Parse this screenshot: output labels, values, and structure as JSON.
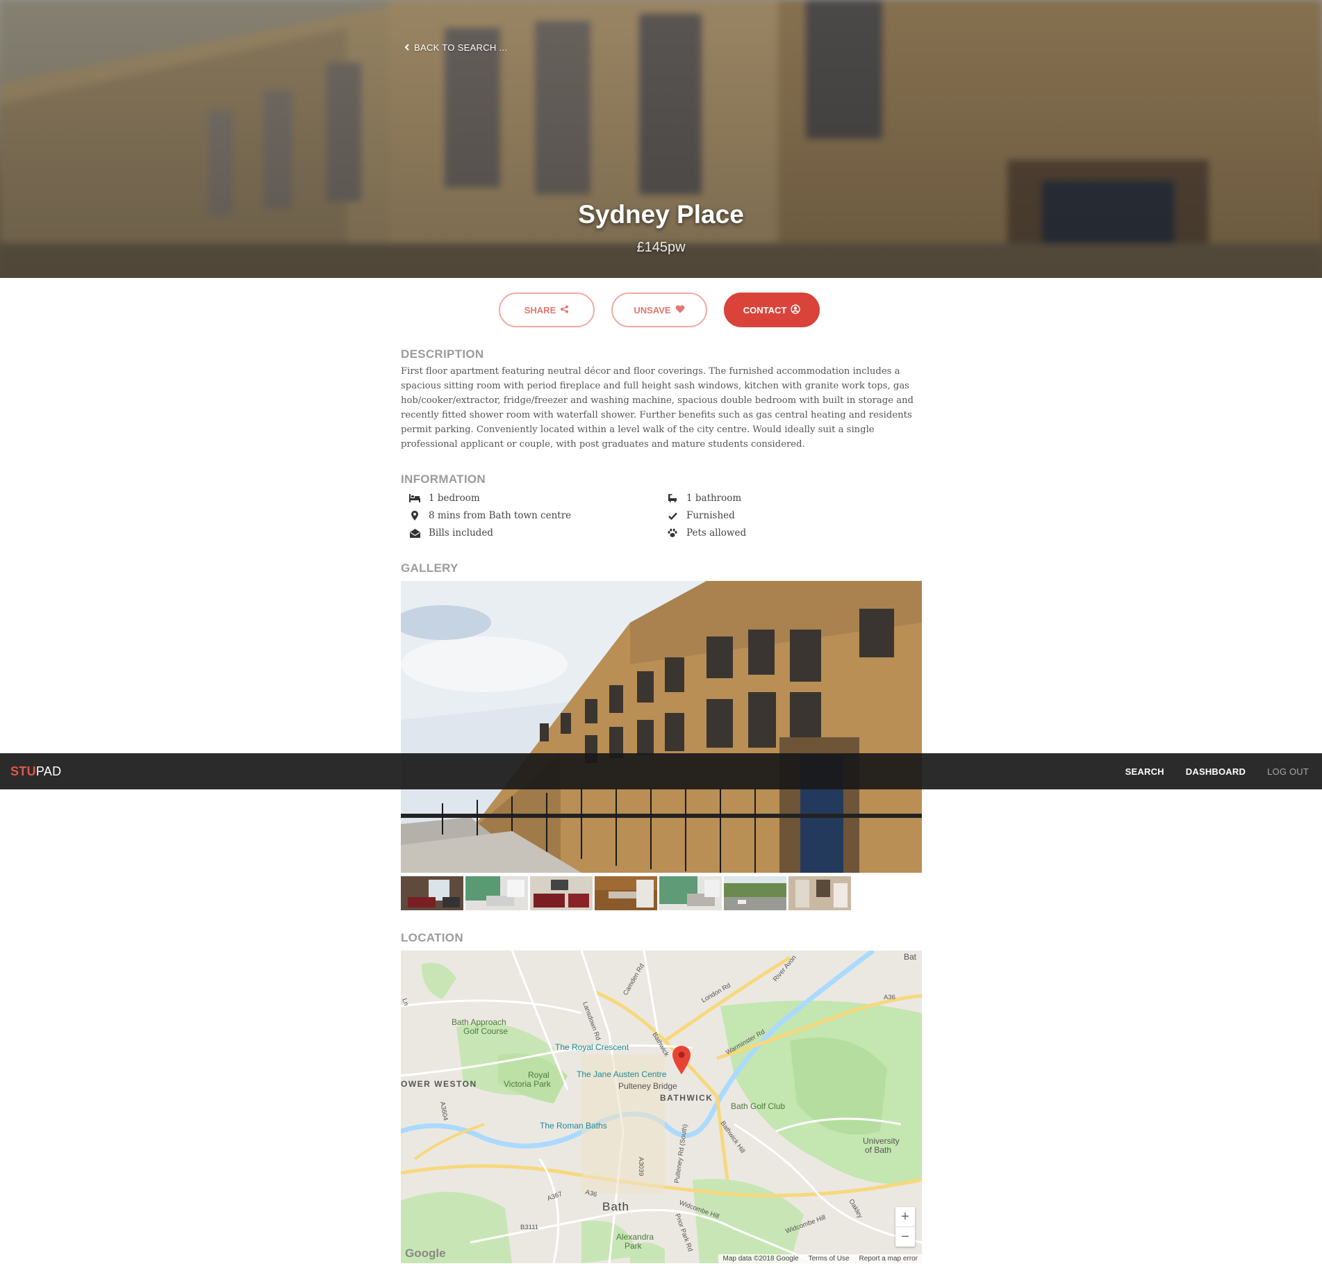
{
  "hero": {
    "back_label": "BACK TO SEARCH ...",
    "title": "Sydney Place",
    "price": "£145pw"
  },
  "actions": {
    "share_label": "SHARE",
    "unsave_label": "UNSAVE",
    "contact_label": "CONTACT"
  },
  "description": {
    "heading": "DESCRIPTION",
    "text": "First floor apartment featuring neutral décor and floor coverings. The furnished accommodation includes a spacious sitting room with period fireplace and full height sash windows, kitchen with granite work tops, gas hob/cooker/extractor, fridge/freezer and washing machine, spacious double bedroom with built in storage and recently fitted shower room with waterfall shower. Further benefits such as gas central heating and residents permit parking. Conveniently located within a level walk of the city centre. Would ideally suit a single professional applicant or couple, with post graduates and mature students considered."
  },
  "information": {
    "heading": "INFORMATION",
    "items": [
      {
        "icon": "bed-icon",
        "text": "1 bedroom"
      },
      {
        "icon": "bath-icon",
        "text": "1 bathroom"
      },
      {
        "icon": "map-pin-icon",
        "text": "8 mins from Bath town centre"
      },
      {
        "icon": "check-icon",
        "text": "Furnished"
      },
      {
        "icon": "envelope-open-icon",
        "text": "Bills included"
      },
      {
        "icon": "paw-icon",
        "text": "Pets allowed"
      }
    ]
  },
  "gallery": {
    "heading": "GALLERY",
    "thumb_count": 7
  },
  "location": {
    "heading": "LOCATION",
    "map_labels": {
      "bath_approach": "Bath Approach",
      "golf_course": "Golf Course",
      "royal_crescent": "The Royal Crescent",
      "royal": "Royal",
      "victoria_park": "Victoria Park",
      "jane_austen": "The Jane Austen Centre",
      "pulteney_bridge": "Pulteney Bridge",
      "bathwick": "BATHWICK",
      "bath_golf_club": "Bath Golf Club",
      "roman_baths": "The Roman Baths",
      "lower_weston": "OWER WESTON",
      "university": "University",
      "of_bath": "of Bath",
      "bath": "Bath",
      "alexandra": "Alexandra",
      "park": "Park",
      "london_rd": "London Rd",
      "warminster_rd": "Warminster Rd",
      "camden_rd": "Camden Rd",
      "lansdown_rd": "Lansdown Rd",
      "river_avon": "River Avon",
      "a36_top": "A36",
      "a36_bottom": "A36",
      "a3604": "A3604",
      "a3039": "A3039",
      "a367": "A367",
      "b3111": "B3111",
      "pulteney_rd": "Pulteney Rd (South)",
      "bathwick_st": "Bathwick",
      "bathwick_hill": "Bathwick Hill",
      "widcombe_hill": "Widcombe Hill",
      "widcombe_hill2": "Widcombe Hill",
      "prior_park_rd": "Prior Park Rd",
      "oakley": "Oakley",
      "bat": "Bat",
      "ln": "Ln"
    },
    "zoom_in": "+",
    "zoom_out": "−",
    "google": "Google",
    "map_data": "Map data ©2018 Google",
    "terms": "Terms of Use",
    "report": "Report a map error"
  },
  "nav": {
    "brand_accent": "STU",
    "brand_rest": "PAD",
    "search": "SEARCH",
    "dashboard": "DASHBOARD",
    "logout": "LOG OUT"
  },
  "colors": {
    "accent": "#d9433a",
    "accent_light": "#f1a9a2",
    "navbar": "#1e1e1e",
    "heading_gray": "#9b9b9b"
  }
}
